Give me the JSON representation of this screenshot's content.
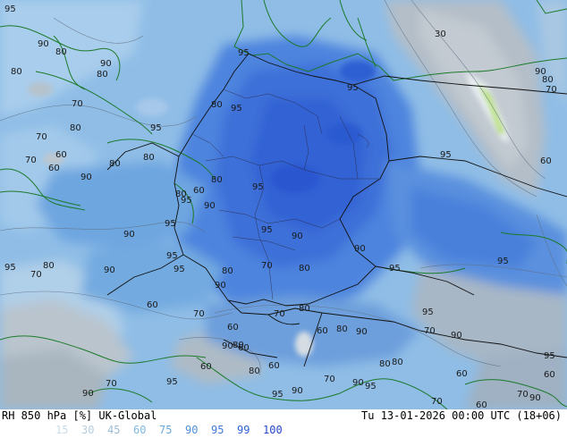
{
  "header": {
    "left_title": "RH 850 hPa [%] UK-Global",
    "right_title": "Tu 13-01-2026 00:00 UTC (18+06)"
  },
  "legend": {
    "items": [
      {
        "label": "15",
        "color": "#c8dcea"
      },
      {
        "label": "30",
        "color": "#b4cde0"
      },
      {
        "label": "45",
        "color": "#9dbdd6"
      },
      {
        "label": "60",
        "color": "#7fb8e2"
      },
      {
        "label": "75",
        "color": "#6aa8dc"
      },
      {
        "label": "90",
        "color": "#4f90da"
      },
      {
        "label": "95",
        "color": "#3f7ad8"
      },
      {
        "label": "99",
        "color": "#2f64d4"
      },
      {
        "label": "100",
        "color": "#2348c8"
      }
    ]
  },
  "map": {
    "contour_labels": [
      {
        "text": "95"
      },
      {
        "text": "90"
      },
      {
        "text": "80"
      },
      {
        "text": "80"
      },
      {
        "text": "90"
      },
      {
        "text": "80"
      },
      {
        "text": "70"
      },
      {
        "text": "80"
      },
      {
        "text": "70"
      },
      {
        "text": "60"
      },
      {
        "text": "70"
      },
      {
        "text": "60"
      },
      {
        "text": "95"
      },
      {
        "text": "80"
      },
      {
        "text": "90"
      },
      {
        "text": "80"
      },
      {
        "text": "95"
      },
      {
        "text": "95"
      },
      {
        "text": "80"
      },
      {
        "text": "95"
      },
      {
        "text": "95"
      },
      {
        "text": "80"
      },
      {
        "text": "60"
      },
      {
        "text": "80"
      },
      {
        "text": "90"
      },
      {
        "text": "95"
      },
      {
        "text": "95"
      },
      {
        "text": "90"
      },
      {
        "text": "95"
      },
      {
        "text": "90"
      },
      {
        "text": "90"
      },
      {
        "text": "95"
      },
      {
        "text": "95"
      },
      {
        "text": "95"
      },
      {
        "text": "80"
      },
      {
        "text": "70"
      },
      {
        "text": "90"
      },
      {
        "text": "95"
      },
      {
        "text": "80"
      },
      {
        "text": "70"
      },
      {
        "text": "80"
      },
      {
        "text": "90"
      },
      {
        "text": "95"
      },
      {
        "text": "60"
      },
      {
        "text": "70"
      },
      {
        "text": "70"
      },
      {
        "text": "80"
      },
      {
        "text": "60"
      },
      {
        "text": "60"
      },
      {
        "text": "90"
      },
      {
        "text": "95"
      },
      {
        "text": "70"
      },
      {
        "text": "90"
      },
      {
        "text": "80"
      },
      {
        "text": "90"
      },
      {
        "text": "60"
      },
      {
        "text": "80"
      },
      {
        "text": "60"
      },
      {
        "text": "70"
      },
      {
        "text": "90"
      },
      {
        "text": "95"
      },
      {
        "text": "80"
      },
      {
        "text": "60"
      },
      {
        "text": "95"
      },
      {
        "text": "90"
      },
      {
        "text": "70"
      },
      {
        "text": "90"
      },
      {
        "text": "95"
      },
      {
        "text": "70"
      },
      {
        "text": "60"
      },
      {
        "text": "80"
      },
      {
        "text": "80"
      },
      {
        "text": "95"
      },
      {
        "text": "95"
      },
      {
        "text": "60"
      },
      {
        "text": "60"
      },
      {
        "text": "70"
      },
      {
        "text": "90"
      },
      {
        "text": "30"
      },
      {
        "text": "90"
      },
      {
        "text": "80"
      },
      {
        "text": "70"
      },
      {
        "text": "60"
      }
    ]
  }
}
